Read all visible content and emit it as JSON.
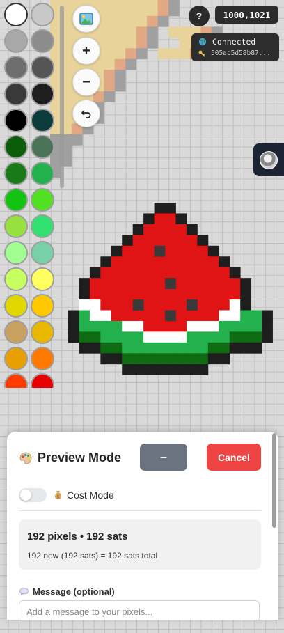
{
  "palette": {
    "colors": [
      "#ffffff",
      "#c8c8c8",
      "#a8a8a8",
      "#8c8c8c",
      "#6e6e6e",
      "#555555",
      "#3a3a3a",
      "#1e1e1e",
      "#000000",
      "#0b3b3b",
      "#0b5d0b",
      "#4b7358",
      "#1a7a1a",
      "#22b14c",
      "#12c312",
      "#52e022",
      "#96e040",
      "#32e070",
      "#a0ff90",
      "#78d0a8",
      "#c8ff60",
      "#ffff60",
      "#e0d800",
      "#ffc800",
      "#c8a060",
      "#e8b800",
      "#e8a000",
      "#ff7800",
      "#ff3c00",
      "#e80000",
      "#c81e28",
      "#ff3c78"
    ],
    "selected_index": 0
  },
  "tools": {
    "image_icon": "image-icon",
    "zoom_in_label": "+",
    "zoom_out_label": "−",
    "undo_icon": "undo-icon"
  },
  "top": {
    "help_label": "?",
    "coords": "1000,1021",
    "status_icon": "globe-icon",
    "status_text": "Connected",
    "key_icon": "key-icon",
    "pubkey": "505ac5d58b87..."
  },
  "panel": {
    "title_icon": "palette-icon",
    "title": "Preview Mode",
    "minimize_label": "–",
    "cancel_label": "Cancel",
    "cost_mode_icon": "money-bag-icon",
    "cost_mode_label": "Cost Mode",
    "cost_mode_enabled": false,
    "summary_main": "192 pixels • 192 sats",
    "summary_sub": "192 new (192 sats) = 192 sats total",
    "message_icon": "speech-bubble-icon",
    "message_label": "Message (optional)",
    "message_placeholder": "Add a message to your pixels...",
    "message_value": ""
  },
  "colors": {
    "accent_red": "#ef4444",
    "button_gray": "#6b7280",
    "dark_bg": "#2c2c2c",
    "watermelon_red": "#e01414",
    "watermelon_green": "#22b14c",
    "dark_green": "#0f6b12",
    "outline": "#1e1e1e",
    "seed": "#3a3a3a",
    "crust_tan": "#e8d39a",
    "crust_orange": "#e2a884"
  }
}
